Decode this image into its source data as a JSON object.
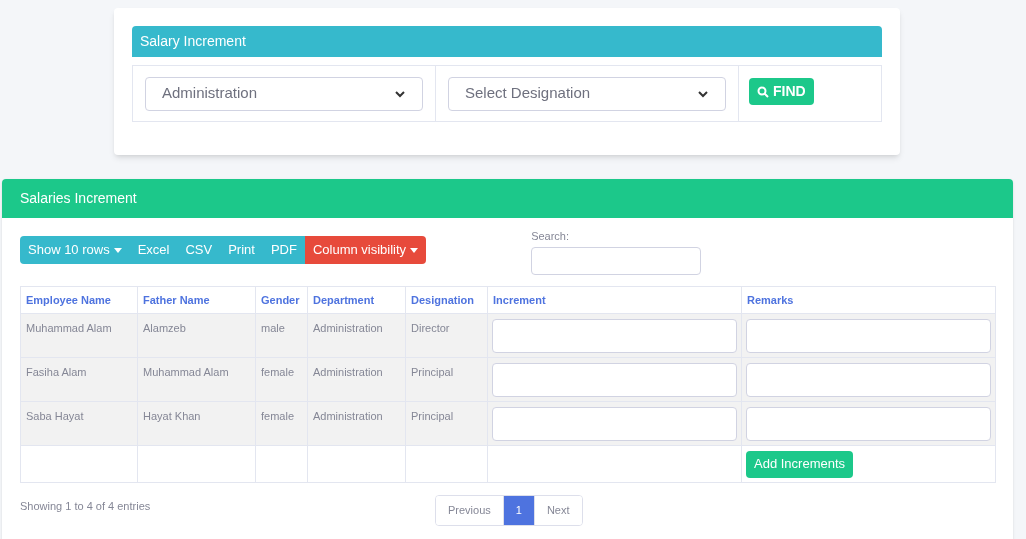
{
  "filter_card": {
    "title": "Salary Increment",
    "department_select": {
      "value": "Administration"
    },
    "designation_select": {
      "value": "Select Designation"
    },
    "find_button": "FIND"
  },
  "salaries_card": {
    "title": "Salaries Increment",
    "toolbar": [
      {
        "label": "Show 10 rows",
        "kind": "dropdown"
      },
      {
        "label": "Excel",
        "kind": "button"
      },
      {
        "label": "CSV",
        "kind": "button"
      },
      {
        "label": "Print",
        "kind": "button"
      },
      {
        "label": "PDF",
        "kind": "button"
      },
      {
        "label": "Column visibility",
        "kind": "danger-dropdown"
      }
    ],
    "search": {
      "label": "Search:"
    },
    "table": {
      "columns": [
        "Employee Name",
        "Father Name",
        "Gender",
        "Department",
        "Designation",
        "Increment",
        "Remarks"
      ],
      "rows": [
        [
          "Muhammad Alam",
          "Alamzeb",
          "male",
          "Administration",
          "Director"
        ],
        [
          "Fasiha Alam",
          "Muhammad Alam",
          "female",
          "Administration",
          "Principal"
        ],
        [
          "Saba Hayat",
          "Hayat Khan",
          "female",
          "Administration",
          "Principal"
        ]
      ],
      "submit_button": "Add Increments"
    },
    "info": "Showing 1 to 4 of 4 entries",
    "pagination": [
      {
        "label": "Previous",
        "selected": false
      },
      {
        "label": "1",
        "selected": true
      },
      {
        "label": "Next",
        "selected": false
      }
    ]
  }
}
